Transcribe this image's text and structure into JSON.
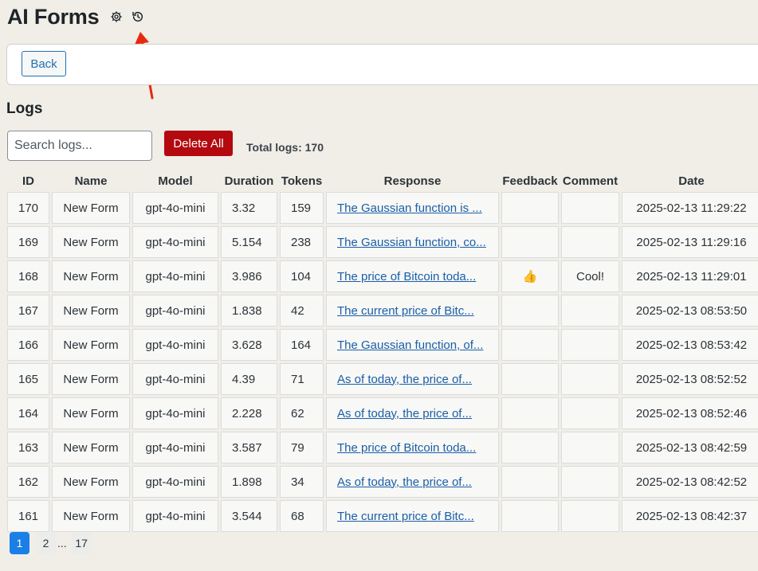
{
  "header": {
    "title": "AI Forms",
    "settings_icon": "gear-icon",
    "history_icon": "history-icon",
    "arrow_color": "#e8290f"
  },
  "toolbar": {
    "back_label": "Back"
  },
  "logs": {
    "heading": "Logs",
    "search_placeholder": "Search logs...",
    "delete_all_label": "Delete All",
    "total_label": "Total logs: 170"
  },
  "table": {
    "columns": [
      "ID",
      "Name",
      "Model",
      "Duration",
      "Tokens",
      "Response",
      "Feedback",
      "Comment",
      "Date"
    ],
    "rows": [
      {
        "id": "170",
        "name": "New Form",
        "model": "gpt-4o-mini",
        "duration": "3.32",
        "tokens": "159",
        "response": "The Gaussian function is ...",
        "feedback": "",
        "comment": "",
        "date": "2025-02-13 11:29:22"
      },
      {
        "id": "169",
        "name": "New Form",
        "model": "gpt-4o-mini",
        "duration": "5.154",
        "tokens": "238",
        "response": "The Gaussian function, co...",
        "feedback": "",
        "comment": "",
        "date": "2025-02-13 11:29:16"
      },
      {
        "id": "168",
        "name": "New Form",
        "model": "gpt-4o-mini",
        "duration": "3.986",
        "tokens": "104",
        "response": "The price of Bitcoin toda...",
        "feedback": "👍",
        "comment": "Cool!",
        "date": "2025-02-13 11:29:01"
      },
      {
        "id": "167",
        "name": "New Form",
        "model": "gpt-4o-mini",
        "duration": "1.838",
        "tokens": "42",
        "response": "The current price of Bitc...",
        "feedback": "",
        "comment": "",
        "date": "2025-02-13 08:53:50"
      },
      {
        "id": "166",
        "name": "New Form",
        "model": "gpt-4o-mini",
        "duration": "3.628",
        "tokens": "164",
        "response": "The Gaussian function, of...",
        "feedback": "",
        "comment": "",
        "date": "2025-02-13 08:53:42"
      },
      {
        "id": "165",
        "name": "New Form",
        "model": "gpt-4o-mini",
        "duration": "4.39",
        "tokens": "71",
        "response": "As of today, the price of...",
        "feedback": "",
        "comment": "",
        "date": "2025-02-13 08:52:52"
      },
      {
        "id": "164",
        "name": "New Form",
        "model": "gpt-4o-mini",
        "duration": "2.228",
        "tokens": "62",
        "response": "As of today, the price of...",
        "feedback": "",
        "comment": "",
        "date": "2025-02-13 08:52:46"
      },
      {
        "id": "163",
        "name": "New Form",
        "model": "gpt-4o-mini",
        "duration": "3.587",
        "tokens": "79",
        "response": "The price of Bitcoin toda...",
        "feedback": "",
        "comment": "",
        "date": "2025-02-13 08:42:59"
      },
      {
        "id": "162",
        "name": "New Form",
        "model": "gpt-4o-mini",
        "duration": "1.898",
        "tokens": "34",
        "response": "As of today, the price of...",
        "feedback": "",
        "comment": "",
        "date": "2025-02-13 08:42:52"
      },
      {
        "id": "161",
        "name": "New Form",
        "model": "gpt-4o-mini",
        "duration": "3.544",
        "tokens": "68",
        "response": "The current price of Bitc...",
        "feedback": "",
        "comment": "",
        "date": "2025-02-13 08:42:37"
      }
    ]
  },
  "pagination": {
    "pages": [
      "1",
      "2",
      "17"
    ],
    "current": "1",
    "ellipsis": "..."
  }
}
